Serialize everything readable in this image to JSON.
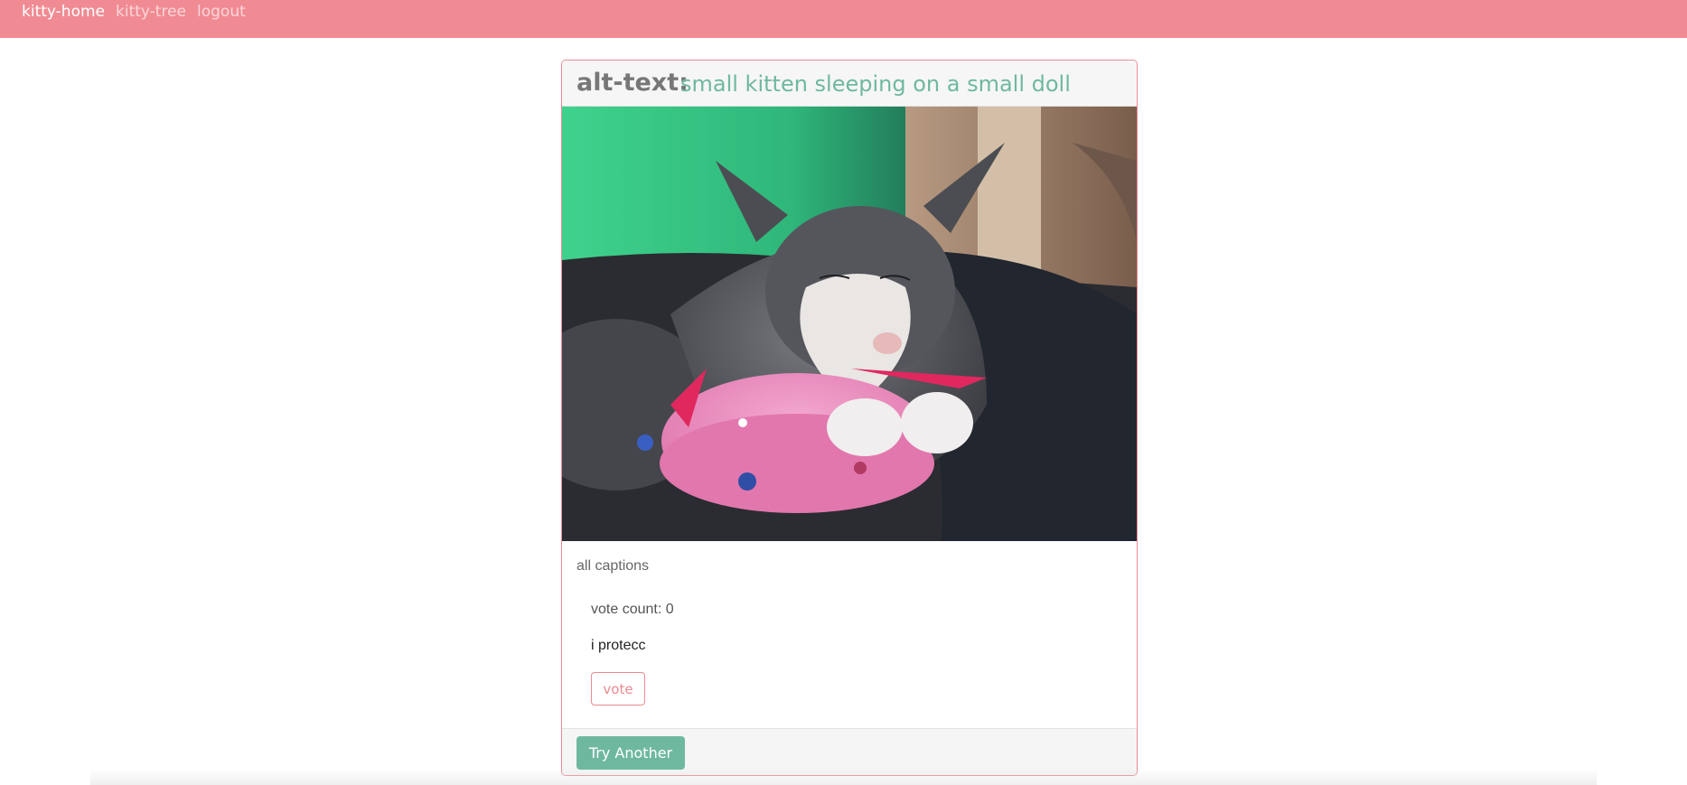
{
  "nav": {
    "items": [
      {
        "label": "kitty-home"
      },
      {
        "label": "kitty-tree"
      },
      {
        "label": "logout"
      }
    ]
  },
  "card": {
    "alt_label": "alt-text:",
    "alt_value": "small kitten sleeping on a small doll",
    "section_label": "all captions",
    "captions": [
      {
        "vote_count": "vote count: 0",
        "text": "i protecc",
        "vote_label": "vote"
      }
    ],
    "try_another_label": "Try Another"
  },
  "colors": {
    "navbar": "#f08b93",
    "accent_pink": "#ea8a92",
    "accent_teal": "#6fb8a0"
  }
}
